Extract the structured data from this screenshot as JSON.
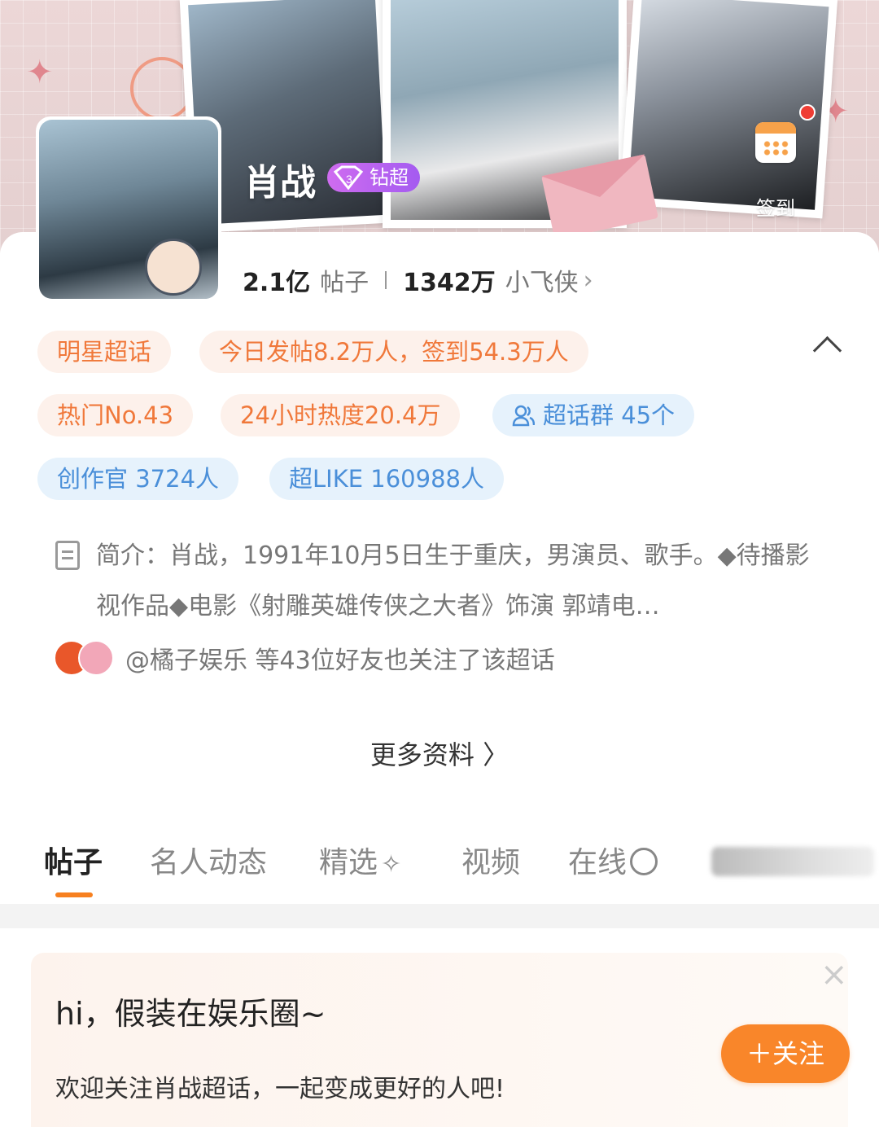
{
  "header": {
    "name": "肖战",
    "badge_level": "3",
    "badge_label": "钻超",
    "checkin_label": "签到"
  },
  "stats": {
    "posts_value": "2.1亿",
    "posts_label": "帖子",
    "fans_value": "1342万",
    "fans_label": "小飞侠"
  },
  "chips": {
    "category": "明星超话",
    "today": "今日发帖8.2万人，签到54.3万人",
    "rank": "热门No.43",
    "heat": "24小时热度20.4万",
    "groups": "超话群 45个",
    "creators": "创作官 3724人",
    "likes": "超LIKE 160988人"
  },
  "intro": {
    "text": "简介：肖战，1991年10月5日生于重庆，男演员、歌手。◆待播影视作品◆电影《射雕英雄传侠之大者》饰演 郭靖电…"
  },
  "friends": {
    "text": "@橘子娱乐 等43位好友也关注了该超话"
  },
  "more": {
    "label": "更多资料 〉"
  },
  "tabs": [
    {
      "label": "帖子"
    },
    {
      "label": "名人动态"
    },
    {
      "label": "精选"
    },
    {
      "label": "视频"
    },
    {
      "label": "在线"
    }
  ],
  "welcome": {
    "title": "hi，假装在娱乐圈~",
    "subtitle": "欢迎关注肖战超话，一起变成更好的人吧!",
    "follow_label": "＋关注",
    "close_icon": "×"
  },
  "colors": {
    "accent": "#f9862a",
    "chip_orange_text": "#f0783a",
    "chip_blue_text": "#4a8fd9"
  }
}
